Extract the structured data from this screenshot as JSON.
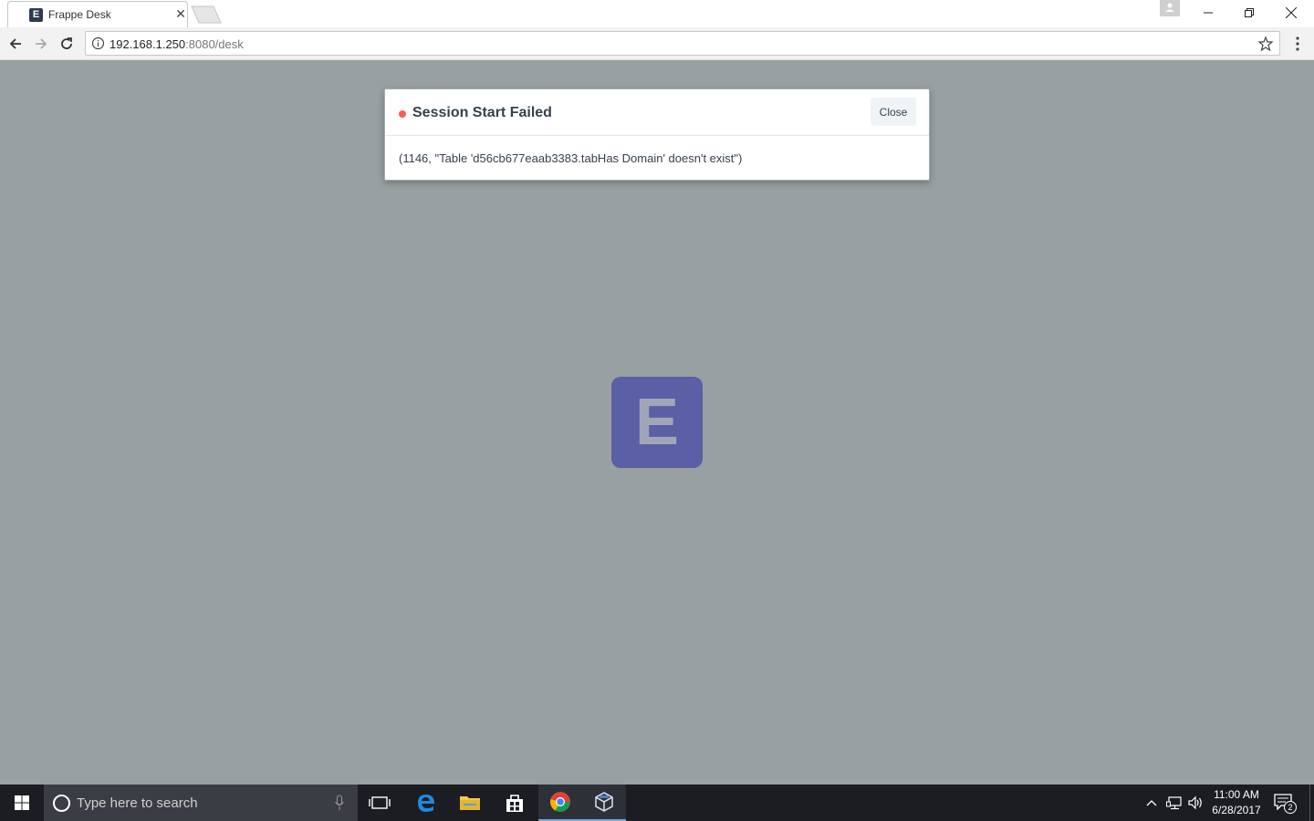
{
  "browser": {
    "tab_title": "Frappe Desk",
    "favicon_letter": "E",
    "url_host": "192.168.1.250",
    "url_rest": ":8080/desk"
  },
  "dialog": {
    "title": "Session Start Failed",
    "close_label": "Close",
    "message": "(1146, \"Table 'd56cb677eaab3383.tabHas Domain' doesn't exist\")",
    "indicator_color": "#ff5858"
  },
  "app": {
    "logo_letter": "E",
    "logo_color": "#5a5fa6"
  },
  "taskbar": {
    "search_placeholder": "Type here to search",
    "time": "11:00 AM",
    "date": "6/28/2017",
    "notification_count": "2",
    "pinned": [
      "task-view-icon",
      "edge-icon",
      "file-explorer-icon",
      "store-icon",
      "chrome-icon",
      "virtualbox-icon"
    ]
  }
}
